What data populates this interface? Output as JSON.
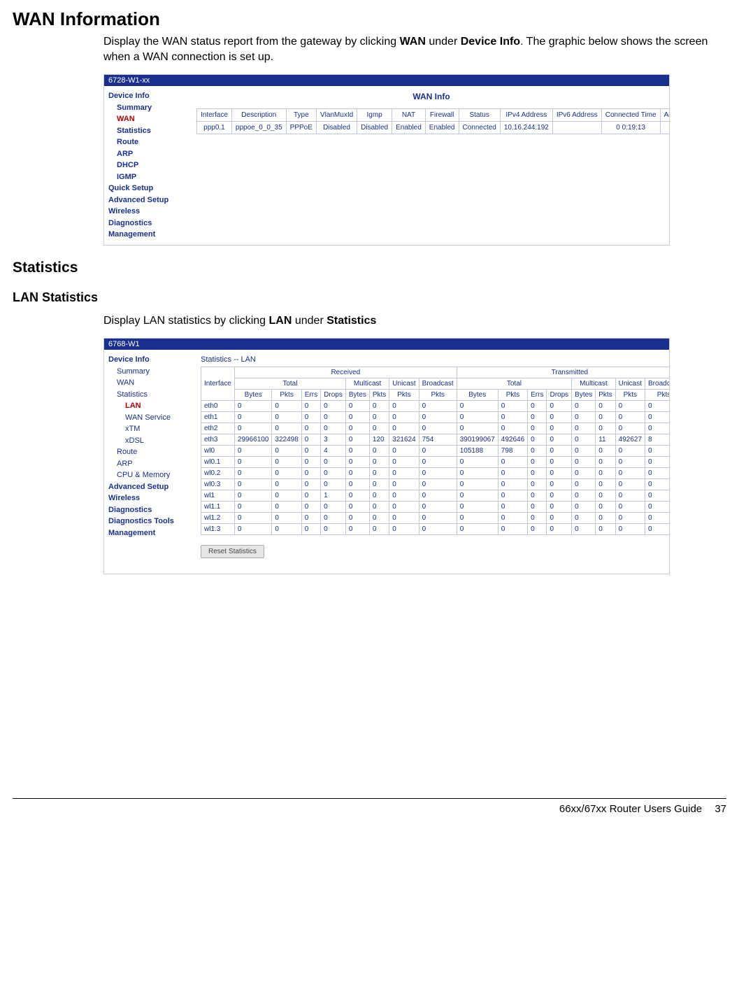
{
  "page": {
    "h1": "WAN Information",
    "para1_a": "Display the WAN status report from the gateway by clicking ",
    "para1_b": "WAN",
    "para1_c": " under ",
    "para1_d": "Device Info",
    "para1_e": ". The graphic below shows the screen when a WAN connection is set up.",
    "h2": "Statistics",
    "h3": "LAN Statistics",
    "para2_a": "Display LAN statistics by clicking ",
    "para2_b": "LAN",
    "para2_c": " under ",
    "para2_d": "Statistics",
    "footer_title": "66xx/67xx Router Users Guide",
    "footer_page": "37"
  },
  "wan_panel": {
    "title": "6728-W1-xx",
    "content_title": "WAN Info",
    "sidebar": [
      {
        "lvl": "t0",
        "label": "Device Info"
      },
      {
        "lvl": "t1",
        "label": "Summary"
      },
      {
        "lvl": "t1 sel",
        "label": "WAN"
      },
      {
        "lvl": "t1",
        "label": "Statistics"
      },
      {
        "lvl": "t1",
        "label": "Route"
      },
      {
        "lvl": "t1",
        "label": "ARP"
      },
      {
        "lvl": "t1",
        "label": "DHCP"
      },
      {
        "lvl": "t1",
        "label": "IGMP"
      },
      {
        "lvl": "t0",
        "label": "Quick Setup"
      },
      {
        "lvl": "t0",
        "label": "Advanced Setup"
      },
      {
        "lvl": "t0",
        "label": "Wireless"
      },
      {
        "lvl": "t0",
        "label": "Diagnostics"
      },
      {
        "lvl": "t0",
        "label": "Management"
      }
    ],
    "headers": [
      "Interface",
      "Description",
      "Type",
      "VlanMuxId",
      "Igmp",
      "NAT",
      "Firewall",
      "Status",
      "IPv4 Address",
      "IPv6 Address",
      "Connected Time",
      "Action"
    ],
    "row": [
      "ppp0.1",
      "pppoe_0_0_35",
      "PPPoE",
      "Disabled",
      "Disabled",
      "Enabled",
      "Enabled",
      "Connected",
      "10.16.244.192",
      "",
      "0 0:19:13",
      ""
    ]
  },
  "lan_panel": {
    "title": "6768-W1",
    "caption": "Statistics -- LAN",
    "reset_label": "Reset Statistics",
    "sidebar": [
      {
        "lvl": "t0",
        "label": "Device Info"
      },
      {
        "lvl": "t1-n",
        "label": "Summary"
      },
      {
        "lvl": "t1-n",
        "label": "WAN"
      },
      {
        "lvl": "t1-n",
        "label": "Statistics"
      },
      {
        "lvl": "t2 sel",
        "label": "LAN"
      },
      {
        "lvl": "t2-n",
        "label": "WAN Service"
      },
      {
        "lvl": "t2-n",
        "label": "xTM"
      },
      {
        "lvl": "t2-n",
        "label": "xDSL"
      },
      {
        "lvl": "t1-n",
        "label": "Route"
      },
      {
        "lvl": "t1-n",
        "label": "ARP"
      },
      {
        "lvl": "t1-n",
        "label": "CPU & Memory"
      },
      {
        "lvl": "t0",
        "label": "Advanced Setup"
      },
      {
        "lvl": "t0",
        "label": "Wireless"
      },
      {
        "lvl": "t0",
        "label": "Diagnostics"
      },
      {
        "lvl": "t0",
        "label": "Diagnostics Tools"
      },
      {
        "lvl": "t0",
        "label": "Management"
      }
    ],
    "top_headers": {
      "h1": "Interface",
      "rx": "Received",
      "tx": "Transmitted"
    },
    "mid_headers": {
      "total": "Total",
      "multicast": "Multicast",
      "unicast": "Unicast",
      "broadcast": "Broadcast"
    },
    "sub_headers": [
      "Bytes",
      "Pkts",
      "Errs",
      "Drops",
      "Bytes",
      "Pkts",
      "Pkts",
      "Pkts",
      "Bytes",
      "Pkts",
      "Errs",
      "Drops",
      "Bytes",
      "Pkts",
      "Pkts",
      "Pkts"
    ],
    "rows": [
      [
        "eth0",
        "0",
        "0",
        "0",
        "0",
        "0",
        "0",
        "0",
        "0",
        "0",
        "0",
        "0",
        "0",
        "0",
        "0",
        "0",
        "0"
      ],
      [
        "eth1",
        "0",
        "0",
        "0",
        "0",
        "0",
        "0",
        "0",
        "0",
        "0",
        "0",
        "0",
        "0",
        "0",
        "0",
        "0",
        "0"
      ],
      [
        "eth2",
        "0",
        "0",
        "0",
        "0",
        "0",
        "0",
        "0",
        "0",
        "0",
        "0",
        "0",
        "0",
        "0",
        "0",
        "0",
        "0"
      ],
      [
        "eth3",
        "29966100",
        "322498",
        "0",
        "3",
        "0",
        "120",
        "321624",
        "754",
        "390199067",
        "492646",
        "0",
        "0",
        "0",
        "11",
        "492627",
        "8"
      ],
      [
        "wl0",
        "0",
        "0",
        "0",
        "4",
        "0",
        "0",
        "0",
        "0",
        "105188",
        "798",
        "0",
        "0",
        "0",
        "0",
        "0",
        "0"
      ],
      [
        "wl0.1",
        "0",
        "0",
        "0",
        "0",
        "0",
        "0",
        "0",
        "0",
        "0",
        "0",
        "0",
        "0",
        "0",
        "0",
        "0",
        "0"
      ],
      [
        "wl0.2",
        "0",
        "0",
        "0",
        "0",
        "0",
        "0",
        "0",
        "0",
        "0",
        "0",
        "0",
        "0",
        "0",
        "0",
        "0",
        "0"
      ],
      [
        "wl0.3",
        "0",
        "0",
        "0",
        "0",
        "0",
        "0",
        "0",
        "0",
        "0",
        "0",
        "0",
        "0",
        "0",
        "0",
        "0",
        "0"
      ],
      [
        "wl1",
        "0",
        "0",
        "0",
        "1",
        "0",
        "0",
        "0",
        "0",
        "0",
        "0",
        "0",
        "0",
        "0",
        "0",
        "0",
        "0"
      ],
      [
        "wl1.1",
        "0",
        "0",
        "0",
        "0",
        "0",
        "0",
        "0",
        "0",
        "0",
        "0",
        "0",
        "0",
        "0",
        "0",
        "0",
        "0"
      ],
      [
        "wl1.2",
        "0",
        "0",
        "0",
        "0",
        "0",
        "0",
        "0",
        "0",
        "0",
        "0",
        "0",
        "0",
        "0",
        "0",
        "0",
        "0"
      ],
      [
        "wl1.3",
        "0",
        "0",
        "0",
        "0",
        "0",
        "0",
        "0",
        "0",
        "0",
        "0",
        "0",
        "0",
        "0",
        "0",
        "0",
        "0"
      ]
    ]
  }
}
